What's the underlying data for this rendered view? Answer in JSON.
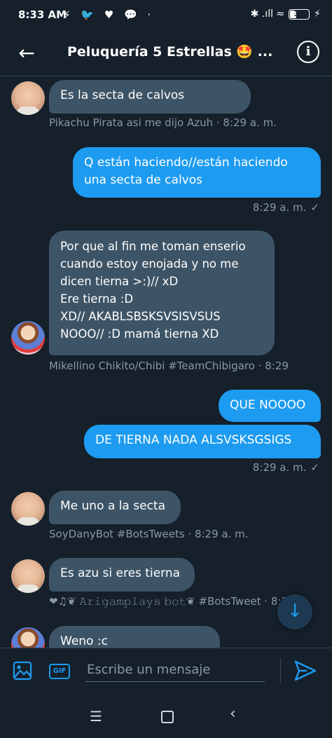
{
  "status_bar": {
    "time": "8:33 AM",
    "left_icons": "⚡ 🐦 ♥ 💬 ·",
    "right_icons": "✱ .ıll ≈",
    "battery": "37",
    "battery_level": 0.37
  },
  "header": {
    "title": "Peluquería 5 Estrellas 🤩 ...",
    "back_icon": "arrow-left",
    "info_icon": "info"
  },
  "messages": [
    {
      "dir": "in",
      "text": "Es la secta de calvos",
      "meta": "Pikachu Pirata asi me dijo Azuh · 8:29 a. m."
    },
    {
      "dir": "out",
      "text": "Q están haciendo//están haciendo una secta de calvos",
      "meta": "8:29 a. m."
    },
    {
      "dir": "in",
      "text": "Por que al fin me toman enserio cuando estoy enojada y no me dicen tierna >:)// xD\nEre tierna :D\nXD// AKABLSBSKSVSISVSUS\nNOOO// :D mamá tierna XD",
      "meta": "Mikellino Chikito/Chibi #TeamChibigaro · 8:29"
    },
    {
      "dir": "out",
      "text": "QUE NOOOO",
      "meta": ""
    },
    {
      "dir": "out",
      "text": "DE TIERNA NADA ALSVSKSGSIGS",
      "meta": "8:29 a. m."
    },
    {
      "dir": "in",
      "text": "Me uno a la secta",
      "meta": "SoyDanyBot #BotsTweets · 8:29 a. m."
    },
    {
      "dir": "in",
      "text": "Es azu si eres tierna",
      "meta": "❤♫❦ 𝙰𝚛𝚒𝚐𝚊𝚖𝚙𝚕𝚊𝚢𝚜 𝚋𝚘𝚝❦ #BotsTweet · 8:29"
    },
    {
      "dir": "in",
      "text": "Weno :c",
      "meta": ""
    }
  ],
  "composer": {
    "placeholder": "Escribe un mensaje",
    "gif_label": "GIF"
  },
  "colors": {
    "background": "#15202b",
    "incoming_bubble": "#3d5466",
    "outgoing_bubble": "#1d9bf0",
    "meta_text": "#8b98a5"
  }
}
